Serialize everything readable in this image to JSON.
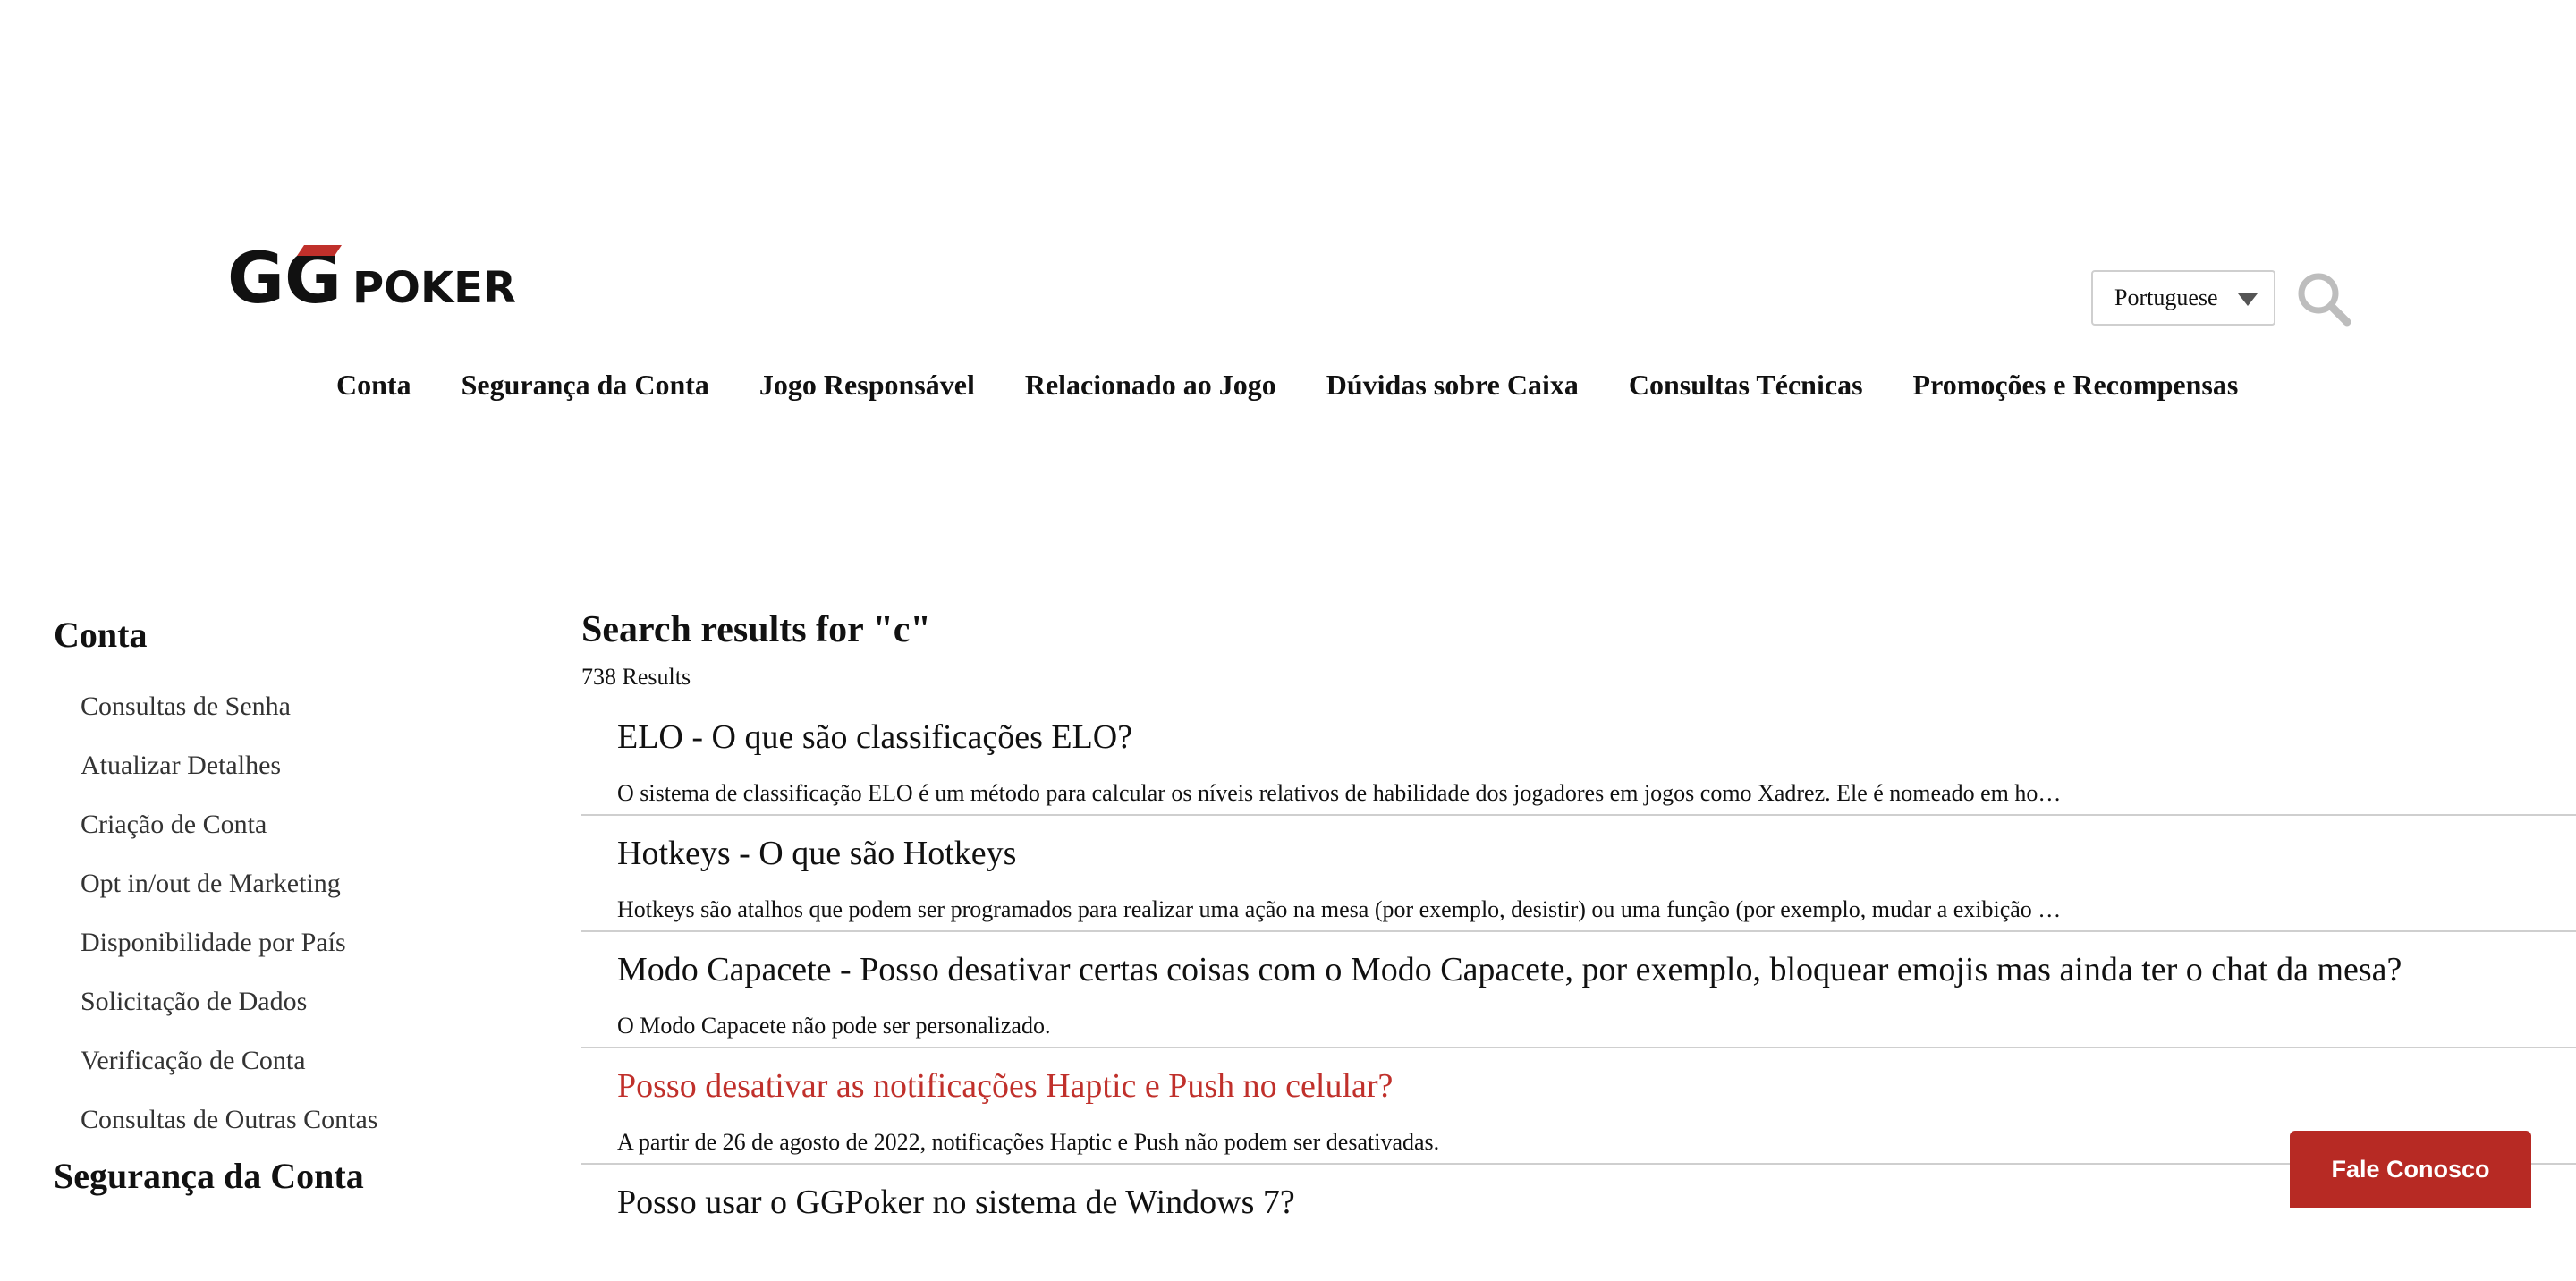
{
  "brand": {
    "logo_text_gg": "GG",
    "logo_text_poker": "POKER",
    "accent": "#c0302b"
  },
  "language": {
    "selected": "Portuguese"
  },
  "search": {
    "icon": "search-icon"
  },
  "nav": {
    "items": [
      "Conta",
      "Segurança da Conta",
      "Jogo Responsável",
      "Relacionado ao Jogo",
      "Dúvidas sobre Caixa",
      "Consultas Técnicas",
      "Promoções e Recompensas"
    ]
  },
  "sidebar": {
    "section_title": "Conta",
    "items": [
      "Consultas de Senha",
      "Atualizar Detalhes",
      "Criação de Conta",
      "Opt in/out de Marketing",
      "Disponibilidade por País",
      "Solicitação de Dados",
      "Verificação de Conta",
      "Consultas de Outras Contas"
    ],
    "next_section_title": "Segurança da Conta"
  },
  "results": {
    "heading": "Search results for \"c\"",
    "count": "738 Results",
    "items": [
      {
        "title": "ELO - O que são classificações ELO?",
        "snippet": "O sistema de classificação ELO é um método para calcular os níveis relativos de habilidade dos jogadores em jogos como Xadrez. Ele é nomeado em ho…"
      },
      {
        "title": "Hotkeys - O que são Hotkeys",
        "snippet": "Hotkeys são atalhos que podem ser programados para realizar uma ação na mesa (por exemplo, desistir) ou uma função (por exemplo, mudar a exibição …"
      },
      {
        "title": "Modo Capacete - Posso desativar certas coisas com o Modo Capacete, por exemplo, bloquear emojis mas ainda ter o chat da mesa?",
        "snippet": "O Modo Capacete não pode ser personalizado."
      },
      {
        "title": "Posso desativar as notificações Haptic e Push no celular?",
        "snippet": "A partir de 26 de agosto de 2022, notificações Haptic e Push não podem ser desativadas."
      },
      {
        "title": "Posso usar o GGPoker no sistema de Windows 7?",
        "snippet": ""
      }
    ]
  },
  "contact": {
    "label": "Fale Conosco"
  }
}
